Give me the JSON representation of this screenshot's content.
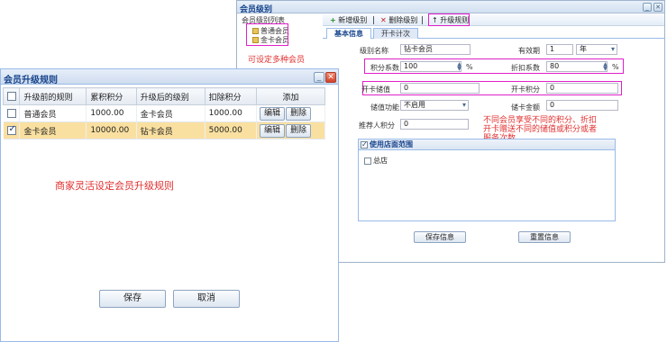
{
  "bg_window": {
    "title": "会员级别",
    "tree": {
      "root": "会员级别列表",
      "items": [
        "普通会员",
        "金卡会员"
      ],
      "note": "可设定多种会员"
    },
    "toolbar": {
      "add": "新增级别",
      "delete": "删除级别",
      "upgrade": "升级规则"
    },
    "tabs": [
      "基本信息",
      "开卡计次"
    ],
    "form": {
      "level_name_label": "级别名称",
      "level_name_value": "钻卡会员",
      "valid_label": "有效期",
      "valid_value": "1",
      "valid_unit": "年",
      "points_rate_label": "积分系数",
      "points_rate_value": "100",
      "discount_rate_label": "折扣系数",
      "discount_rate_value": "80",
      "percent": "%",
      "card_fee_label": "开卡储值",
      "card_fee_value": "0",
      "card_points_label": "开卡积分",
      "card_points_value": "0",
      "extra_label": "储值功能",
      "extra_value": "不启用",
      "deposit_label": "储卡金额",
      "deposit_value": "0",
      "referrer_label": "推荐人积分",
      "referrer_value": "0"
    },
    "note_lines": [
      "不同会员享受不同的积分、折扣",
      "开卡赠送不同的储值或积分或者",
      "服务次数"
    ],
    "scope": {
      "header": "使用店面范围",
      "item": "总店"
    },
    "buttons": {
      "save": "保存信息",
      "reset": "重置信息"
    }
  },
  "dialog": {
    "title": "会员升级规则",
    "columns": [
      "升级前的规则",
      "累积积分",
      "升级后的级别",
      "扣除积分",
      "添加"
    ],
    "rows": [
      {
        "before": "普通会员",
        "points": "1000.00",
        "after": "金卡会员",
        "deduct": "1000.00",
        "checked": false
      },
      {
        "before": "金卡会员",
        "points": "10000.00",
        "after": "钻卡会员",
        "deduct": "5000.00",
        "checked": true
      }
    ],
    "edit_label": "编辑",
    "delete_label": "删除",
    "note": "商家灵活设定会员升级规则",
    "save_label": "保存",
    "cancel_label": "取消"
  }
}
